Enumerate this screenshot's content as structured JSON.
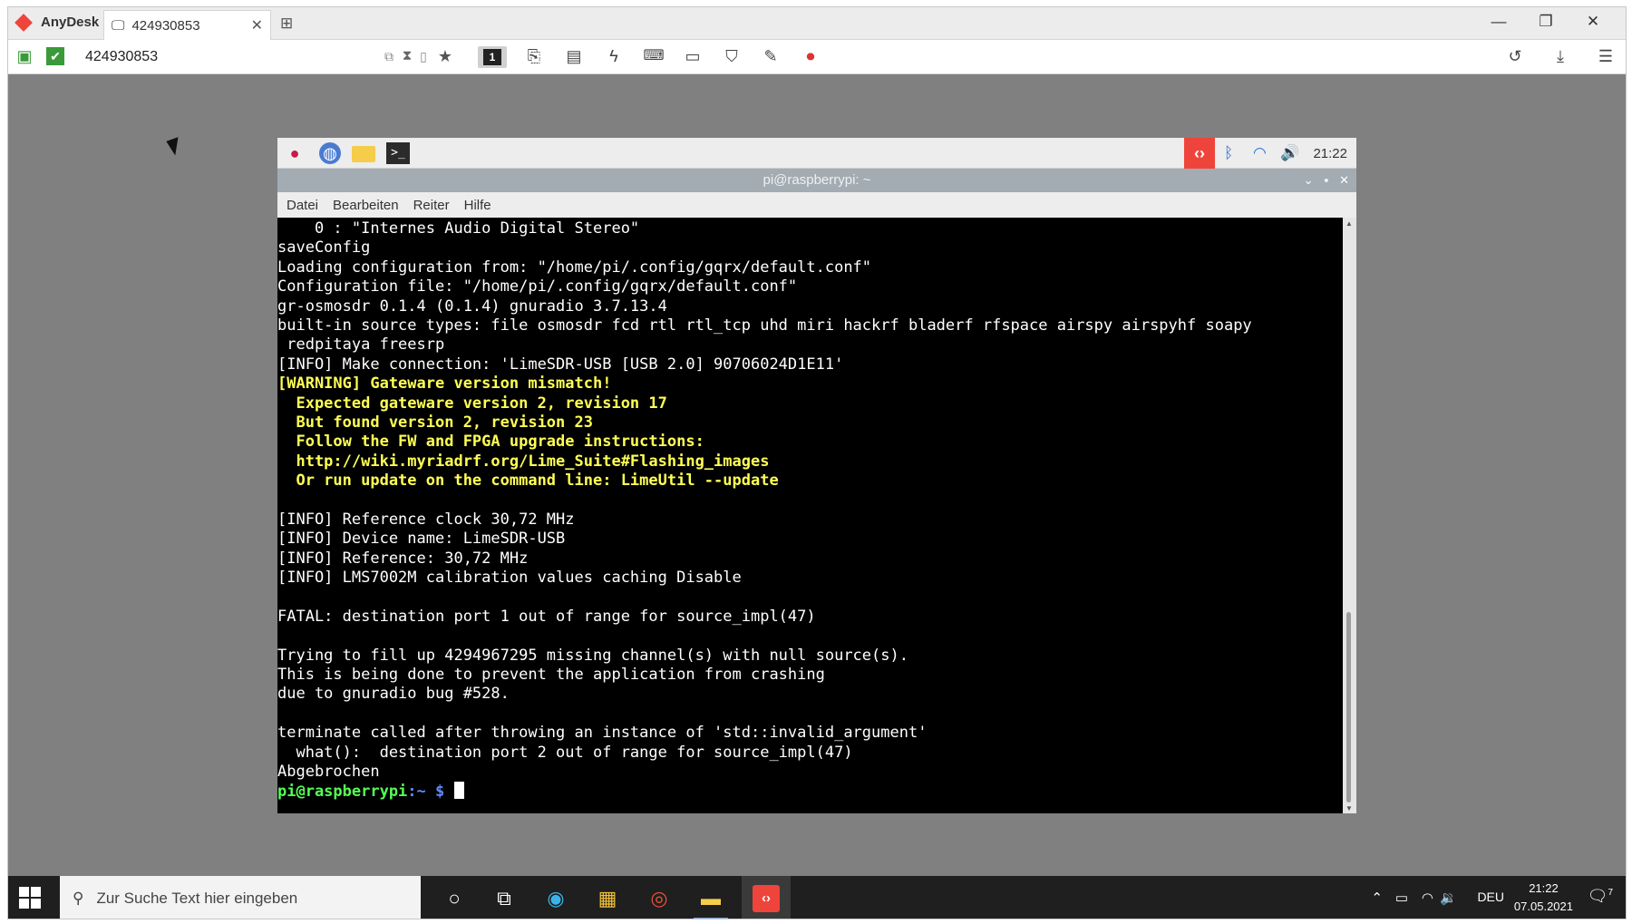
{
  "anydesk": {
    "app_name": "AnyDesk",
    "tab_title": "424930853",
    "tab_close": "✕",
    "new_tab": "⊞",
    "window_controls": [
      "—",
      "❐",
      "✕"
    ],
    "address_value": "424930853",
    "monitor_label": "1",
    "brand_color": "#ef443b"
  },
  "pi": {
    "panel_icons": [
      "raspberry-icon",
      "browser-icon",
      "file-manager-icon",
      "terminal-icon"
    ],
    "terminal_icon_text": ">_",
    "clock": "21:22",
    "window_title": "pi@raspberrypi: ~",
    "menu": [
      "Datei",
      "Bearbeiten",
      "Reiter",
      "Hilfe"
    ],
    "prompt_user": "pi@raspberrypi",
    "prompt_path": ":~ ",
    "prompt_dollar": "$ ",
    "lines": [
      {
        "text": "    0 : \"Internes Audio Digital Stereo\"",
        "style": ""
      },
      {
        "text": "saveConfig",
        "style": ""
      },
      {
        "text": "Loading configuration from: \"/home/pi/.config/gqrx/default.conf\"",
        "style": ""
      },
      {
        "text": "Configuration file: \"/home/pi/.config/gqrx/default.conf\"",
        "style": ""
      },
      {
        "text": "gr-osmosdr 0.1.4 (0.1.4) gnuradio 3.7.13.4",
        "style": ""
      },
      {
        "text": "built-in source types: file osmosdr fcd rtl rtl_tcp uhd miri hackrf bladerf rfspace airspy airspyhf soapy",
        "style": ""
      },
      {
        "text": " redpitaya freesrp",
        "style": ""
      },
      {
        "text": "[INFO] Make connection: 'LimeSDR-USB [USB 2.0] 90706024D1E11'",
        "style": ""
      },
      {
        "text": "[WARNING] Gateware version mismatch!",
        "style": "warn"
      },
      {
        "text": "  Expected gateware version 2, revision 17",
        "style": "warn"
      },
      {
        "text": "  But found version 2, revision 23",
        "style": "warn"
      },
      {
        "text": "  Follow the FW and FPGA upgrade instructions:",
        "style": "warn"
      },
      {
        "text": "  http://wiki.myriadrf.org/Lime_Suite#Flashing_images",
        "style": "warn"
      },
      {
        "text": "  Or run update on the command line: LimeUtil --update",
        "style": "warn"
      },
      {
        "text": "",
        "style": ""
      },
      {
        "text": "[INFO] Reference clock 30,72 MHz",
        "style": ""
      },
      {
        "text": "[INFO] Device name: LimeSDR-USB",
        "style": ""
      },
      {
        "text": "[INFO] Reference: 30,72 MHz",
        "style": ""
      },
      {
        "text": "[INFO] LMS7002M calibration values caching Disable",
        "style": ""
      },
      {
        "text": "",
        "style": ""
      },
      {
        "text": "FATAL: destination port 1 out of range for source_impl(47)",
        "style": ""
      },
      {
        "text": "",
        "style": ""
      },
      {
        "text": "Trying to fill up 4294967295 missing channel(s) with null source(s).",
        "style": ""
      },
      {
        "text": "This is being done to prevent the application from crashing",
        "style": ""
      },
      {
        "text": "due to gnuradio bug #528.",
        "style": ""
      },
      {
        "text": "",
        "style": ""
      },
      {
        "text": "terminate called after throwing an instance of 'std::invalid_argument'",
        "style": ""
      },
      {
        "text": "  what():  destination port 2 out of range for source_impl(47)",
        "style": ""
      },
      {
        "text": "Abgebrochen",
        "style": ""
      }
    ],
    "colors": {
      "warning": "#ffff55",
      "prompt": "#55ff55",
      "dollar": "#5c8cff"
    }
  },
  "taskbar": {
    "search_placeholder": "Zur Suche Text hier eingeben",
    "apps": [
      "cortana-icon",
      "task-view-icon",
      "edge-icon",
      "store-icon",
      "chrome-icon",
      "file-explorer-icon",
      "anydesk-icon"
    ],
    "language": "DEU",
    "time": "21:22",
    "date": "07.05.2021",
    "notification_count": "7"
  }
}
